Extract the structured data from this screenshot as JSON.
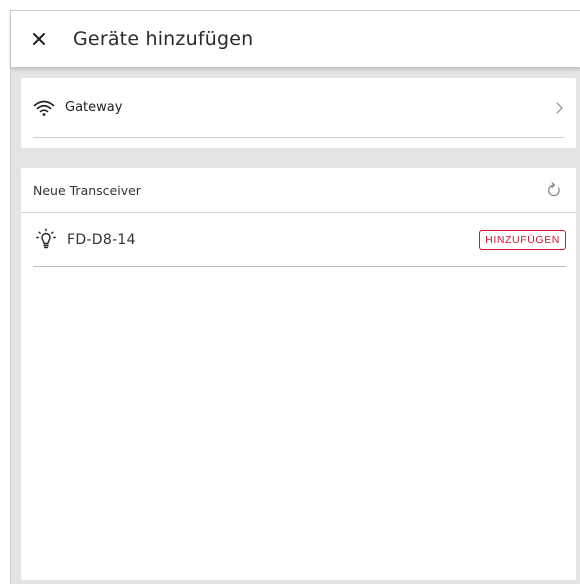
{
  "header": {
    "title": "Geräte hinzufügen",
    "close_icon": "close-icon"
  },
  "gateway": {
    "label": "Gateway",
    "icon": "wifi-icon"
  },
  "transceivers": {
    "section_title": "Neue Transceiver",
    "refresh_icon": "refresh-icon",
    "items": [
      {
        "name": "FD-D8-14",
        "icon": "lightbulb-icon",
        "action_label": "HINZUFÜGEN"
      }
    ]
  },
  "colors": {
    "accent": "#d2182e",
    "background": "#e3e3e3"
  }
}
